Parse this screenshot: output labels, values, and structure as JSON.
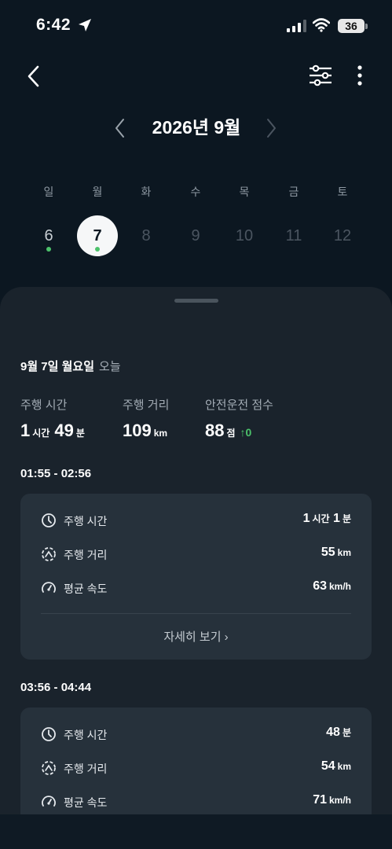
{
  "status_bar": {
    "time": "6:42",
    "battery": "36"
  },
  "calendar": {
    "month_title": "2026년 9월",
    "weekdays": [
      "일",
      "월",
      "화",
      "수",
      "목",
      "금",
      "토"
    ],
    "dates": [
      "6",
      "7",
      "8",
      "9",
      "10",
      "11",
      "12"
    ],
    "selected_date": "7",
    "dates_with_data": [
      "6",
      "7"
    ]
  },
  "summary": {
    "day_title": "9월 7일 월요일",
    "today_label": "오늘",
    "drive_time_label": "주행 시간",
    "drive_time_hours": "1",
    "hours_unit": "시간",
    "drive_time_minutes": "49",
    "minutes_unit": "분",
    "distance_label": "주행 거리",
    "distance_value": "109",
    "distance_unit": "km",
    "score_label": "안전운전 점수",
    "score_value": "88",
    "score_unit": "점",
    "score_delta": "0"
  },
  "trips": [
    {
      "time_range": "01:55 - 02:56",
      "drive_time_label": "주행 시간",
      "drive_time_h": "1",
      "drive_time_h_unit": "시간",
      "drive_time_m": "1",
      "drive_time_m_unit": "분",
      "distance_label": "주행 거리",
      "distance": "55",
      "distance_unit": "km",
      "speed_label": "평균 속도",
      "speed": "63",
      "speed_unit": "km/h",
      "detail_label": "자세히 보기 ›"
    },
    {
      "time_range": "03:56 - 04:44",
      "drive_time_label": "주행 시간",
      "drive_time_m": "48",
      "drive_time_m_unit": "분",
      "distance_label": "주행 거리",
      "distance": "54",
      "distance_unit": "km",
      "speed_label": "평균 속도",
      "speed": "71",
      "speed_unit": "km/h"
    }
  ],
  "colors": {
    "background": "#0c1721",
    "sheet": "#1a232c",
    "card": "#26313b",
    "accent_green": "#4cc26b"
  },
  "icons": [
    "location-arrow-icon",
    "signal-icon",
    "wifi-icon",
    "back-icon",
    "filter-icon",
    "more-icon",
    "chevron-left-icon",
    "chevron-right-icon",
    "clock-icon",
    "distance-icon",
    "speed-icon",
    "arrow-up-icon"
  ]
}
